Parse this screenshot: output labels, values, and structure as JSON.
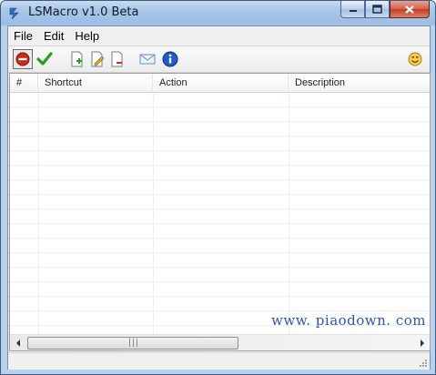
{
  "window": {
    "title": "LSMacro v1.0 Beta"
  },
  "menu": {
    "items": [
      "File",
      "Edit",
      "Help"
    ]
  },
  "toolbar": {
    "tooltips": []
  },
  "list": {
    "columns": [
      "#",
      "Shortcut",
      "Action",
      "Description"
    ],
    "rows": []
  },
  "watermark": "www. piaodown. com",
  "colors": {
    "accent": "#2a56b5",
    "stop": "#c42b1c",
    "ok": "#2e9c1f"
  },
  "icons": [
    "stop-icon",
    "check-icon",
    "new-macro-icon",
    "edit-macro-icon",
    "delete-macro-icon",
    "mail-icon",
    "info-icon",
    "smiley-icon"
  ]
}
